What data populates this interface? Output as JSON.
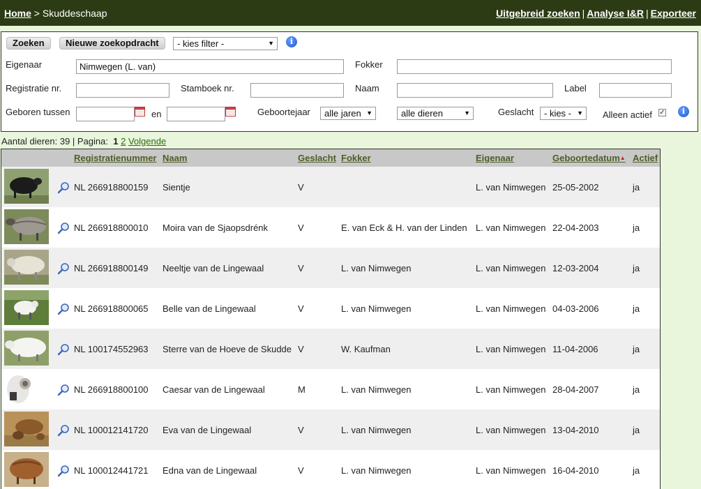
{
  "topbar": {
    "home": "Home",
    "crumb_sep": ">",
    "crumb": "Skuddeschaap",
    "links": [
      "Uitgebreid zoeken",
      "Analyse I&R",
      "Exporteer"
    ],
    "link_sep": "|"
  },
  "filter": {
    "search_button": "Zoeken",
    "new_search_button": "Nieuwe zoekopdracht",
    "filter_select": "- kies filter -",
    "eigenaar_label": "Eigenaar",
    "eigenaar_value": "Nimwegen (L. van)",
    "fokker_label": "Fokker",
    "fokker_value": "",
    "registratie_label": "Registratie nr.",
    "registratie_value": "",
    "stamboek_label": "Stamboek nr.",
    "stamboek_value": "",
    "naam_label": "Naam",
    "naam_value": "",
    "label_label": "Label",
    "label_value": "",
    "geboren_label": "Geboren tussen",
    "en_label": "en",
    "geboren_from": "",
    "geboren_to": "",
    "geboortejaar_label": "Geboortejaar",
    "geboortejaar_select": "alle jaren",
    "dieren_select": "alle dieren",
    "geslacht_label": "Geslacht",
    "geslacht_select": "- kies -",
    "alleen_actief_label": "Alleen actief",
    "alleen_actief_checked": "✓",
    "info_glyph": "i"
  },
  "count": {
    "prefix": "Aantal dieren: 39 | Pagina:",
    "current_page": "1",
    "page2": "2",
    "next": "Volgende"
  },
  "table": {
    "columns": [
      "Registratienummer",
      "Naam",
      "Geslacht",
      "Fokker",
      "Eigenaar",
      "Geboortedatum",
      "Actief"
    ],
    "sort_arrow": "▲",
    "rows": [
      {
        "reg": "NL 266918800159",
        "naam": "Sientje",
        "geslacht": "V",
        "fokker": "",
        "eigenaar": "L. van Nimwegen",
        "datum": "25-05-2002",
        "actief": "ja",
        "photo": "black-sheep"
      },
      {
        "reg": "NL 266918800010",
        "naam": "Moira van de Sjaopsdrénk",
        "geslacht": "V",
        "fokker": "E. van Eck & H. van der Linden",
        "eigenaar": "L. van Nimwegen",
        "datum": "22-04-2003",
        "actief": "ja",
        "photo": "grey-sheep"
      },
      {
        "reg": "NL 266918800149",
        "naam": "Neeltje van de Lingewaal",
        "geslacht": "V",
        "fokker": "L. van Nimwegen",
        "eigenaar": "L. van Nimwegen",
        "datum": "12-03-2004",
        "actief": "ja",
        "photo": "white-sheep"
      },
      {
        "reg": "NL 266918800065",
        "naam": "Belle van de Lingewaal",
        "geslacht": "V",
        "fokker": "L. van Nimwegen",
        "eigenaar": "L. van Nimwegen",
        "datum": "04-03-2006",
        "actief": "ja",
        "photo": "white-sheep-grass"
      },
      {
        "reg": "NL 100174552963",
        "naam": "Sterre van de Hoeve de Skudde",
        "geslacht": "V",
        "fokker": "W. Kaufman",
        "eigenaar": "L. van Nimwegen",
        "datum": "11-04-2006",
        "actief": "ja",
        "photo": "white-sheep-wide"
      },
      {
        "reg": "NL 266918800100",
        "naam": "Caesar van de Lingewaal",
        "geslacht": "M",
        "fokker": "L. van Nimwegen",
        "eigenaar": "L. van Nimwegen",
        "datum": "28-04-2007",
        "actief": "ja",
        "photo": "ram-head"
      },
      {
        "reg": "NL 100012141720",
        "naam": "Eva van de Lingewaal",
        "geslacht": "V",
        "fokker": "L. van Nimwegen",
        "eigenaar": "L. van Nimwegen",
        "datum": "13-04-2010",
        "actief": "ja",
        "photo": "brown-sheep-lambs"
      },
      {
        "reg": "NL 100012441721",
        "naam": "Edna van de Lingewaal",
        "geslacht": "V",
        "fokker": "L. van Nimwegen",
        "eigenaar": "L. van Nimwegen",
        "datum": "16-04-2010",
        "actief": "ja",
        "photo": "brown-sheep"
      }
    ]
  },
  "colors": {
    "topbar": "#2d3b15",
    "page_bg": "#e9f6dc",
    "header_link": "#4e5e28",
    "row_odd": "#efefef"
  }
}
